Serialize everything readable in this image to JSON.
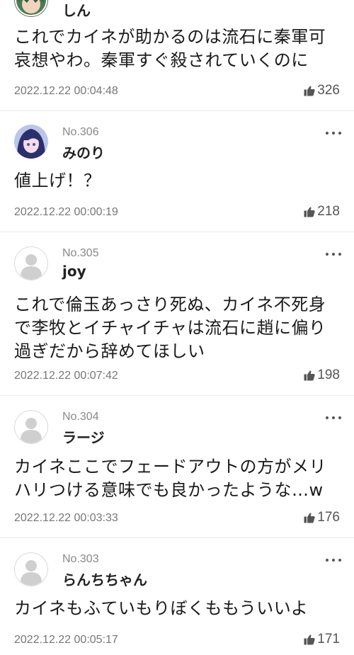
{
  "comments": [
    {
      "name": "しん",
      "avatar": "anime-character-avatar",
      "text": [
        "これでカイネが助かるのは流石に秦軍可",
        "哀想やわ。秦軍すぐ殺されていくのに"
      ],
      "timestamp": "2022.12.22 00:04:48",
      "likes": "326"
    },
    {
      "number": "No.306",
      "name": "みのり",
      "avatar": "anime-girl-avatar",
      "text": [
        "値上げ！？"
      ],
      "timestamp": "2022.12.22 00:00:19",
      "likes": "218"
    },
    {
      "number": "No.305",
      "name": "joy",
      "avatar": "default-user-avatar",
      "text": [
        "これで倫玉あっさり死ぬ、カイネ不死身",
        "で李牧とイチャイチャは流石に趙に偏り",
        "過ぎだから辞めてほしい"
      ],
      "timestamp": "2022.12.22 00:07:42",
      "likes": "198"
    },
    {
      "number": "No.304",
      "name": "ラージ",
      "avatar": "default-user-avatar",
      "text": [
        "カイネここでフェードアウトの方がメリ",
        "ハリつける意味でも良かったような…w"
      ],
      "timestamp": "2022.12.22 00:03:33",
      "likes": "176"
    },
    {
      "number": "No.303",
      "name": "らんちちゃん",
      "avatar": "default-user-avatar",
      "text": [
        "カイネもふていもりぼくももういいよ"
      ],
      "timestamp": "2022.12.22 00:05:17",
      "likes": "171"
    }
  ],
  "icons": {
    "like": "thumbs-up-icon",
    "more": "more-options-icon"
  },
  "colors": {
    "text": "#1a1a1a",
    "meta": "#777777",
    "divider": "#ececec"
  }
}
